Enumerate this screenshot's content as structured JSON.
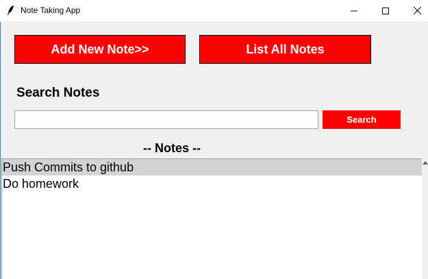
{
  "window": {
    "title": "Note Taking App",
    "icon": "feather-icon",
    "controls": [
      "minimize-icon",
      "maximize-icon",
      "close-icon"
    ]
  },
  "toolbar": {
    "add_note_label": "Add New Note>>",
    "list_notes_label": "List All Notes"
  },
  "search": {
    "heading": "Search Notes",
    "value": "",
    "placeholder": "",
    "button_label": "Search"
  },
  "notes": {
    "heading": "-- Notes --",
    "items": [
      {
        "label": "Push Commits to github",
        "selected": true
      },
      {
        "label": "Do homework",
        "selected": false
      }
    ]
  },
  "colors": {
    "accent": "#ff0000",
    "window_bg": "#f0f0f0",
    "selection": "#d3d3d3"
  }
}
